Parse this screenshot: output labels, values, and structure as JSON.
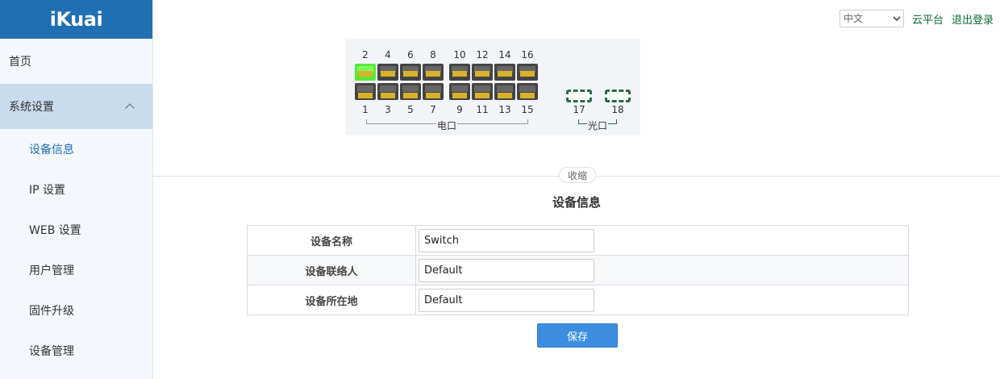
{
  "sidebar": {
    "logo": "iKuai",
    "items": [
      {
        "label": "首页"
      },
      {
        "label": "系统设置"
      }
    ],
    "sub_items": [
      {
        "label": "设备信息"
      },
      {
        "label": "IP 设置"
      },
      {
        "label": "WEB 设置"
      },
      {
        "label": "用户管理"
      },
      {
        "label": "固件升级"
      },
      {
        "label": "设备管理"
      }
    ]
  },
  "topbar": {
    "language": "中文",
    "cloud_link": "云平台",
    "logout_link": "退出登录"
  },
  "panel": {
    "top_port_numbers": [
      "2",
      "4",
      "6",
      "8",
      "10",
      "12",
      "14",
      "16"
    ],
    "bottom_port_numbers": [
      "1",
      "3",
      "5",
      "7",
      "9",
      "11",
      "13",
      "15"
    ],
    "sfp_numbers": [
      "17",
      "18"
    ],
    "electric_label": "电口",
    "optical_label": "光口",
    "active_port": "2",
    "colors": {
      "active": "#57e83a",
      "inactive": "#444444",
      "pins": "#d8b22a"
    }
  },
  "collapse_label": "收缩",
  "section_title": "设备信息",
  "form": {
    "rows": [
      {
        "label": "设备名称",
        "value": "Switch"
      },
      {
        "label": "设备联络人",
        "value": "Default"
      },
      {
        "label": "设备所在地",
        "value": "Default"
      }
    ],
    "save_label": "保存"
  }
}
